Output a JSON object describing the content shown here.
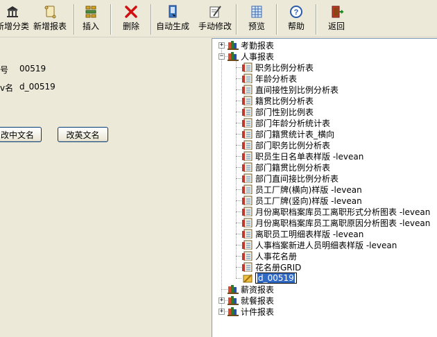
{
  "toolbar": {
    "buttons": [
      {
        "label": "新增分类",
        "icon": "bank-icon"
      },
      {
        "label": "新增报表",
        "icon": "scroll-icon"
      },
      {
        "label": "插入",
        "icon": "insert-icon"
      },
      {
        "label": "删除",
        "icon": "red-x-icon"
      },
      {
        "label": "自动生成",
        "icon": "auto-generate-icon"
      },
      {
        "label": "手动修改",
        "icon": "edit-icon"
      },
      {
        "label": "预览",
        "icon": "grid-icon"
      },
      {
        "label": "帮助",
        "icon": "help-icon"
      },
      {
        "label": "返回",
        "icon": "exit-door-icon"
      }
    ]
  },
  "form": {
    "id_label": "号",
    "id_value": "00519",
    "name_label": "v名",
    "name_value": "d_00519",
    "change_cn_button": "改中文名",
    "change_en_button": "改英文名"
  },
  "tree": {
    "categories": [
      {
        "label": "考勤报表",
        "expanded": false
      },
      {
        "label": "人事报表",
        "expanded": true
      },
      {
        "label": "薪资报表",
        "expanded": false
      },
      {
        "label": "就餐报表",
        "expanded": false
      },
      {
        "label": "计件报表",
        "expanded": false
      }
    ],
    "hr_items": [
      "职务比例分析表",
      "年龄分析表",
      "直间接性别比例分析表",
      "籍贯比例分析表",
      "部门性别比例表",
      "部门年龄分析统计表",
      "部门籍贯统计表_横向",
      "部门职务比例分析表",
      "职员生日名单表样版 -levean",
      "部门籍贯比例分析表",
      "部门直间接比例分析表",
      "员工厂牌(横向)样版 -levean",
      "员工厂牌(竖向)样版 -levean",
      "月份离职档案库员工离职形式分析图表 -levean",
      "月份离职档案库员工离职原因分析图表 -levean",
      "离职员工明细表样版 -levean",
      "人事档案新进人员明细表样版 -levean",
      "人事花名册",
      "花名册GRID"
    ],
    "selected_item": "d_00519"
  }
}
